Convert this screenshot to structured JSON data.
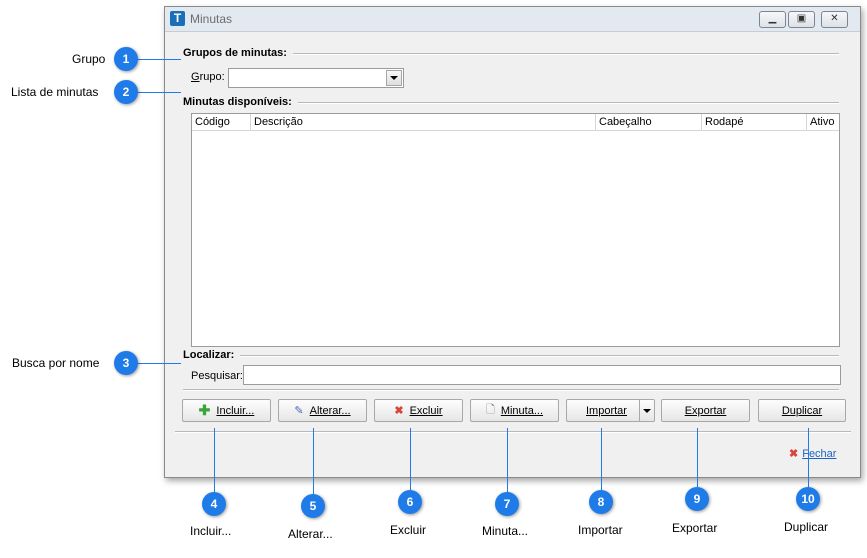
{
  "window": {
    "title": "Minutas",
    "app_icon_letter": "T"
  },
  "group_section": {
    "title": "Grupos de minutas:",
    "label_prefix": "G",
    "label_rest": "rupo:",
    "combo_value": ""
  },
  "list_section": {
    "title": "Minutas disponíveis:",
    "columns": [
      "Código",
      "Descrição",
      "Cabeçalho",
      "Rodapé",
      "Ativo"
    ]
  },
  "search_section": {
    "title": "Localizar:",
    "label": "Pesquisar:",
    "value": ""
  },
  "buttons": {
    "incluir": "Incluir...",
    "alterar": "Alterar...",
    "excluir": "Excluir",
    "minuta": "Minuta...",
    "importar": "Importar",
    "exportar": "Exportar",
    "duplicar": "Duplicar",
    "fechar": "Fechar"
  },
  "callouts": {
    "grupo": {
      "num": "1",
      "text": "Grupo"
    },
    "lista": {
      "num": "2",
      "text": "Lista de minutas"
    },
    "busca": {
      "num": "3",
      "text": "Busca por nome"
    },
    "incluir": {
      "num": "4",
      "text": "Incluir..."
    },
    "alterar": {
      "num": "5",
      "text": "Alterar..."
    },
    "excluir": {
      "num": "6",
      "text": "Excluir"
    },
    "minuta": {
      "num": "7",
      "text": "Minuta..."
    },
    "importar": {
      "num": "8",
      "text": "Importar"
    },
    "exportar": {
      "num": "9",
      "text": "Exportar"
    },
    "duplicar": {
      "num": "10",
      "text": "Duplicar"
    }
  },
  "colors": {
    "callout": "#1e7be8",
    "close_icon": "#d9443b",
    "window_bg": "#f0f0f0"
  }
}
